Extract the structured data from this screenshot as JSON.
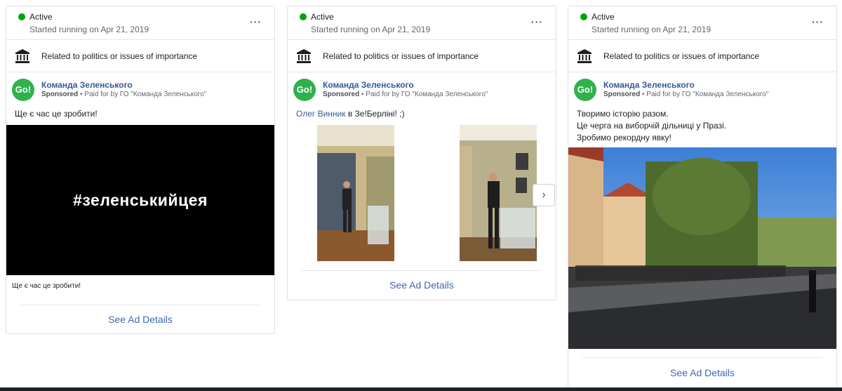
{
  "status_label": "Active",
  "started": "Started running on Apr 21, 2019",
  "more": "···",
  "category": "Related to politics or issues of importance",
  "page_name": "Команда Зеленського",
  "sponsored_prefix": "Sponsored",
  "paid_for": " • Paid for by ГО \"Команда Зеленського\"",
  "logo_text": "Go!",
  "see_details": "See Ad Details",
  "icons": {
    "status": "green-dot",
    "more": "more-options-icon",
    "category": "bank-building-icon",
    "carousel_next": "chevron-right-icon"
  },
  "colors": {
    "active": "#00a400",
    "link": "#4267b2",
    "page_name": "#365899",
    "logo": "#2fb24c"
  },
  "cards": [
    {
      "text": "Ще є час це зробити!",
      "image_text": "#зеленськийцея",
      "caption": "Ще є час це зробити!"
    },
    {
      "text_link": "Олег Винник",
      "text_rest": " в Зе!Берліні! ;)",
      "carousel_arrow": "›"
    },
    {
      "text_lines": [
        "Творимо історію разом.",
        "Це черга на виборчій дільниці у Празі.",
        "Зробимо рекордну явку!"
      ]
    }
  ]
}
